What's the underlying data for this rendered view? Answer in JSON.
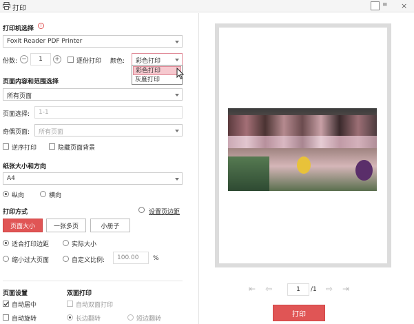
{
  "window": {
    "title": "打印"
  },
  "printer": {
    "section_title": "打印机选择",
    "selected": "Foxit Reader PDF Printer"
  },
  "copies": {
    "label": "份数:",
    "value": "1",
    "collate_label": "逐份打印",
    "color_label": "颜色:",
    "color_selected": "彩色打印",
    "color_options": [
      "彩色打印",
      "灰度打印"
    ]
  },
  "page_range": {
    "section_title": "页面内容和范围选择",
    "range_selected": "所有页面",
    "page_select_label": "页面选择:",
    "page_select_placeholder": "1-1",
    "odd_even_label": "奇偶页面:",
    "odd_even_selected": "所有页面",
    "reverse_label": "逆序打印",
    "hide_bg_label": "隐藏页面背景"
  },
  "paper": {
    "section_title": "纸张大小和方向",
    "size_selected": "A4",
    "portrait_label": "纵向",
    "landscape_label": "横向"
  },
  "print_mode": {
    "section_title": "打印方式",
    "margin_link": "设置页边距",
    "buttons": [
      "页面大小",
      "一张多页",
      "小册子"
    ],
    "fit_margin_label": "适合打印边距",
    "actual_size_label": "实际大小",
    "shrink_label": "缩小过大页面",
    "custom_scale_label": "自定义比例:",
    "custom_scale_value": "100.00",
    "percent": "%"
  },
  "page_settings": {
    "section_title": "页面设置",
    "auto_center_label": "自动居中",
    "auto_rotate_label": "自动旋转"
  },
  "duplex": {
    "section_title": "双面打印",
    "auto_duplex_label": "自动双面打印",
    "long_edge_label": "长边翻转",
    "short_edge_label": "短边翻转"
  },
  "preview": {
    "page_value": "1",
    "page_total": "/1"
  },
  "actions": {
    "print_label": "打印"
  },
  "colors": {
    "accent": "#e05555",
    "highlight": "#f6c9cf"
  }
}
